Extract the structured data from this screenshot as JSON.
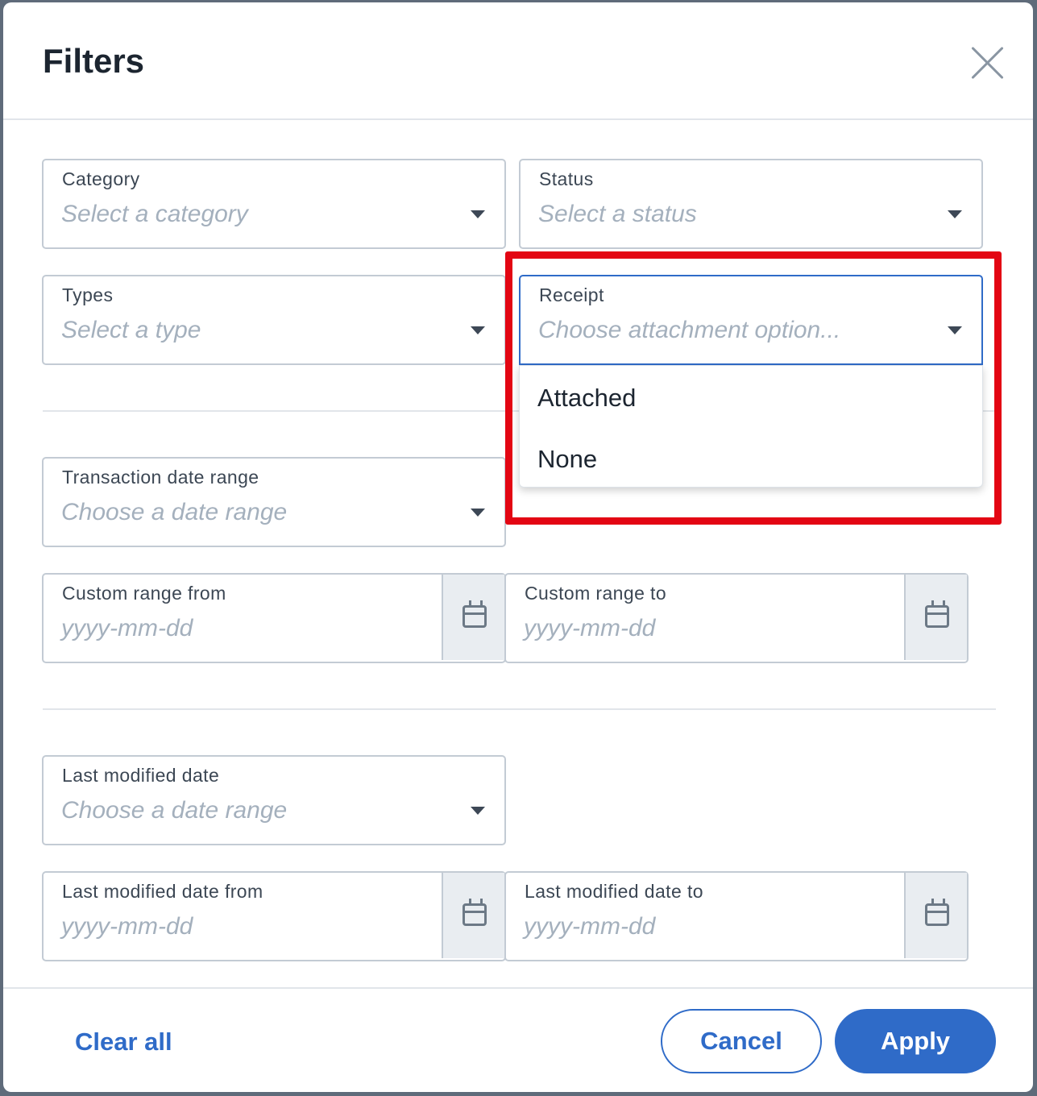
{
  "dialog": {
    "title": "Filters"
  },
  "fields": {
    "category": {
      "label": "Category",
      "placeholder": "Select a category"
    },
    "status": {
      "label": "Status",
      "placeholder": "Select a status"
    },
    "types": {
      "label": "Types",
      "placeholder": "Select a type"
    },
    "receipt": {
      "label": "Receipt",
      "placeholder": "Choose attachment option..."
    },
    "transaction_date_range": {
      "label": "Transaction date range",
      "placeholder": "Choose a date range"
    },
    "custom_range_from": {
      "label": "Custom range from",
      "placeholder": "yyyy-mm-dd"
    },
    "custom_range_to": {
      "label": "Custom range to",
      "placeholder": "yyyy-mm-dd"
    },
    "last_modified_date": {
      "label": "Last modified date",
      "placeholder": "Choose a date range"
    },
    "last_modified_from": {
      "label": "Last modified date from",
      "placeholder": "yyyy-mm-dd"
    },
    "last_modified_to": {
      "label": "Last modified date to",
      "placeholder": "yyyy-mm-dd"
    }
  },
  "receipt_dropdown": {
    "options": [
      "Attached",
      "None"
    ]
  },
  "footer": {
    "clear_all": "Clear all",
    "cancel": "Cancel",
    "apply": "Apply"
  },
  "colors": {
    "accent": "#2f6bc8",
    "highlight": "#e30613"
  }
}
